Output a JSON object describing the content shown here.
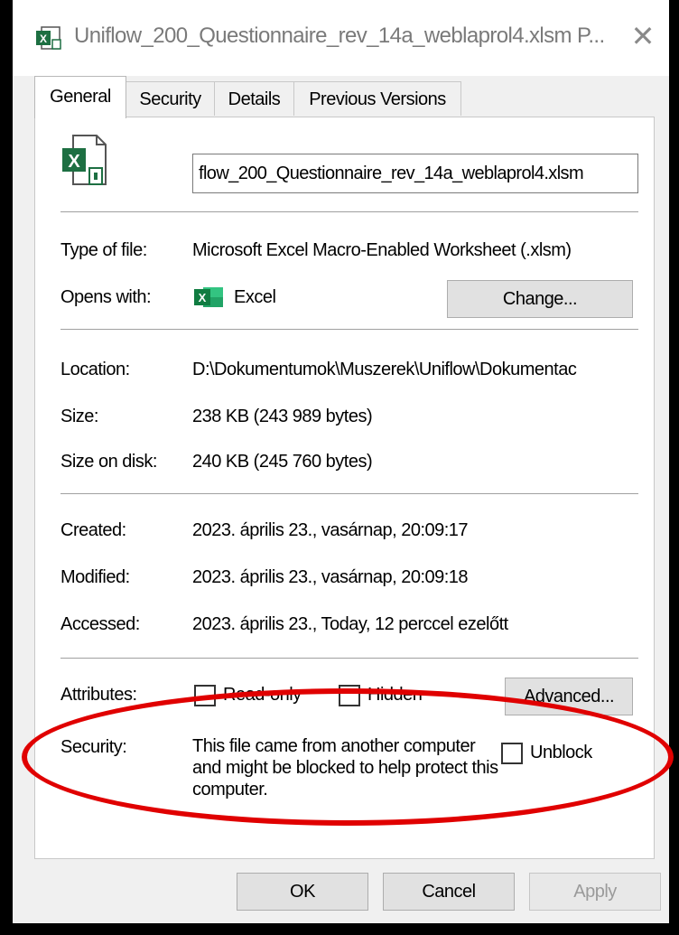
{
  "window": {
    "title": "Uniflow_200_Questionnaire_rev_14a_weblaprol4.xlsm P...",
    "close_glyph": "✕",
    "accent_red": "#e00000"
  },
  "tabs": [
    {
      "label": "General",
      "active": true
    },
    {
      "label": "Security",
      "active": false
    },
    {
      "label": "Details",
      "active": false
    },
    {
      "label": "Previous Versions",
      "active": false
    }
  ],
  "general": {
    "filename": "flow_200_Questionnaire_rev_14a_weblaprol4.xlsm",
    "file_icon": "excel-macro-file-icon",
    "type_label": "Type of file:",
    "type_value": "Microsoft Excel Macro-Enabled Worksheet (.xlsm)",
    "opens_label": "Opens with:",
    "opens_value": "Excel",
    "opens_icon": "excel-icon",
    "change_button": "Change...",
    "location_label": "Location:",
    "location_value": "D:\\Dokumentumok\\Muszerek\\Uniflow\\Dokumentac",
    "size_label": "Size:",
    "size_value": "238 KB (243 989 bytes)",
    "size_disk_label": "Size on disk:",
    "size_disk_value": "240 KB (245 760 bytes)",
    "created_label": "Created:",
    "created_value": "2023. április 23., vasárnap, 20:09:17",
    "modified_label": "Modified:",
    "modified_value": "2023. április 23., vasárnap, 20:09:18",
    "accessed_label": "Accessed:",
    "accessed_value": "2023. április 23., Today, 12 perccel ezelőtt",
    "attributes_label": "Attributes:",
    "readonly_label": "Read-only",
    "readonly_checked": false,
    "hidden_label": "Hidden",
    "hidden_checked": false,
    "advanced_button": "Advanced...",
    "security_label": "Security:",
    "security_text": "This file came from another computer and might be blocked to help protect this computer.",
    "unblock_label": "Unblock",
    "unblock_checked": false
  },
  "footer": {
    "ok": "OK",
    "cancel": "Cancel",
    "apply": "Apply"
  }
}
